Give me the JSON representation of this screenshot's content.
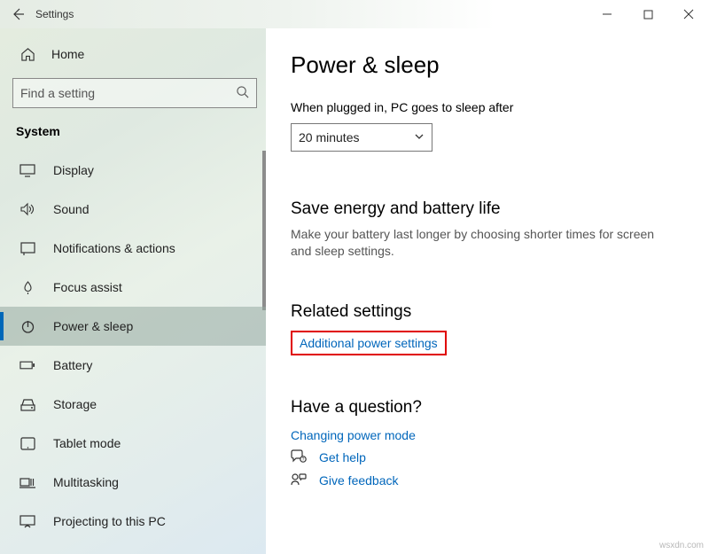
{
  "titlebar": {
    "title": "Settings"
  },
  "sidebar": {
    "home": "Home",
    "search_placeholder": "Find a setting",
    "category": "System",
    "items": [
      {
        "label": "Display"
      },
      {
        "label": "Sound"
      },
      {
        "label": "Notifications & actions"
      },
      {
        "label": "Focus assist"
      },
      {
        "label": "Power & sleep"
      },
      {
        "label": "Battery"
      },
      {
        "label": "Storage"
      },
      {
        "label": "Tablet mode"
      },
      {
        "label": "Multitasking"
      },
      {
        "label": "Projecting to this PC"
      }
    ]
  },
  "main": {
    "title": "Power & sleep",
    "field_label": "When plugged in, PC goes to sleep after",
    "dropdown_value": "20 minutes",
    "energy_heading": "Save energy and battery life",
    "energy_body": "Make your battery last longer by choosing shorter times for screen and sleep settings.",
    "related_heading": "Related settings",
    "related_link": "Additional power settings",
    "question_heading": "Have a question?",
    "question_link": "Changing power mode",
    "get_help": "Get help",
    "give_feedback": "Give feedback"
  },
  "watermark": "wsxdn.com"
}
